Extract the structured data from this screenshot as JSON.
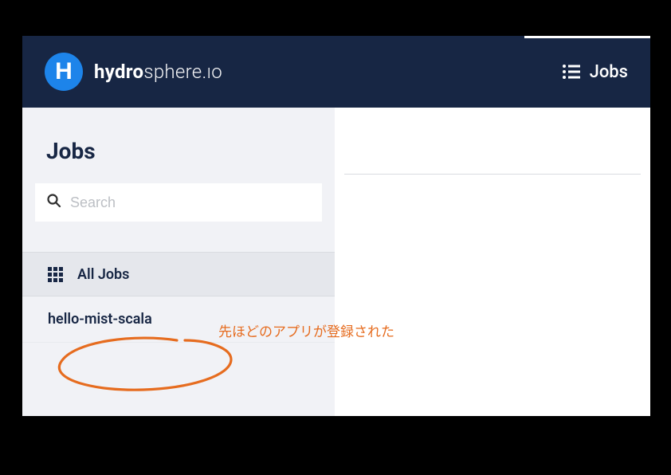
{
  "header": {
    "logo_letter": "H",
    "logo_bold": "hydro",
    "logo_light": "sphere.ıo",
    "nav_jobs": "Jobs"
  },
  "sidebar": {
    "title": "Jobs",
    "search_placeholder": "Search",
    "filter_label": "All Jobs"
  },
  "jobs": [
    {
      "name": "hello-mist-scala"
    }
  ],
  "annotation": {
    "text": "先ほどのアプリが登録された"
  }
}
